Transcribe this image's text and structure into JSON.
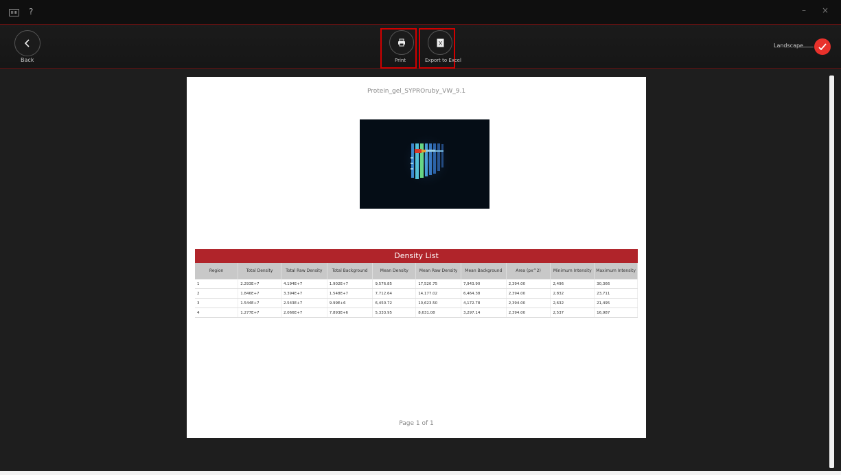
{
  "titlebar": {
    "help": "?",
    "minimize": "–",
    "close": "×"
  },
  "toolbar": {
    "back_label": "Back",
    "print_label": "Print",
    "export_label": "Export to Excel",
    "landscape_label": "Landscape",
    "landscape_checked": true
  },
  "document": {
    "title": "Protein_gel_SYPROruby_VW_9.1",
    "table_title": "Density List",
    "columns": [
      "Region",
      "Total Density",
      "Total Raw Density",
      "Total Background",
      "Mean Density",
      "Mean Raw Density",
      "Mean Background",
      "Area (px^2)",
      "Minimum Intensity",
      "Maximum Intensity"
    ],
    "rows": [
      [
        "1",
        "2.293E+7",
        "4.194E+7",
        "1.902E+7",
        "9,576.85",
        "17,520.75",
        "7,943.90",
        "2,394.00",
        "2,496",
        "30,366"
      ],
      [
        "2",
        "1.846E+7",
        "3.394E+7",
        "1.548E+7",
        "7,712.64",
        "14,177.02",
        "6,464.38",
        "2,394.00",
        "2,832",
        "23,711"
      ],
      [
        "3",
        "1.544E+7",
        "2.543E+7",
        "9.99E+6",
        "6,450.72",
        "10,623.50",
        "4,172.78",
        "2,394.00",
        "2,632",
        "21,495"
      ],
      [
        "4",
        "1.277E+7",
        "2.066E+7",
        "7.893E+6",
        "5,333.95",
        "8,631.08",
        "3,297.14",
        "2,394.00",
        "2,537",
        "16,987"
      ]
    ],
    "page_label": "Page 1 of 1"
  },
  "colors": {
    "accent": "#e8312b",
    "table_header": "#b0242a",
    "highlight": "#d10000"
  }
}
